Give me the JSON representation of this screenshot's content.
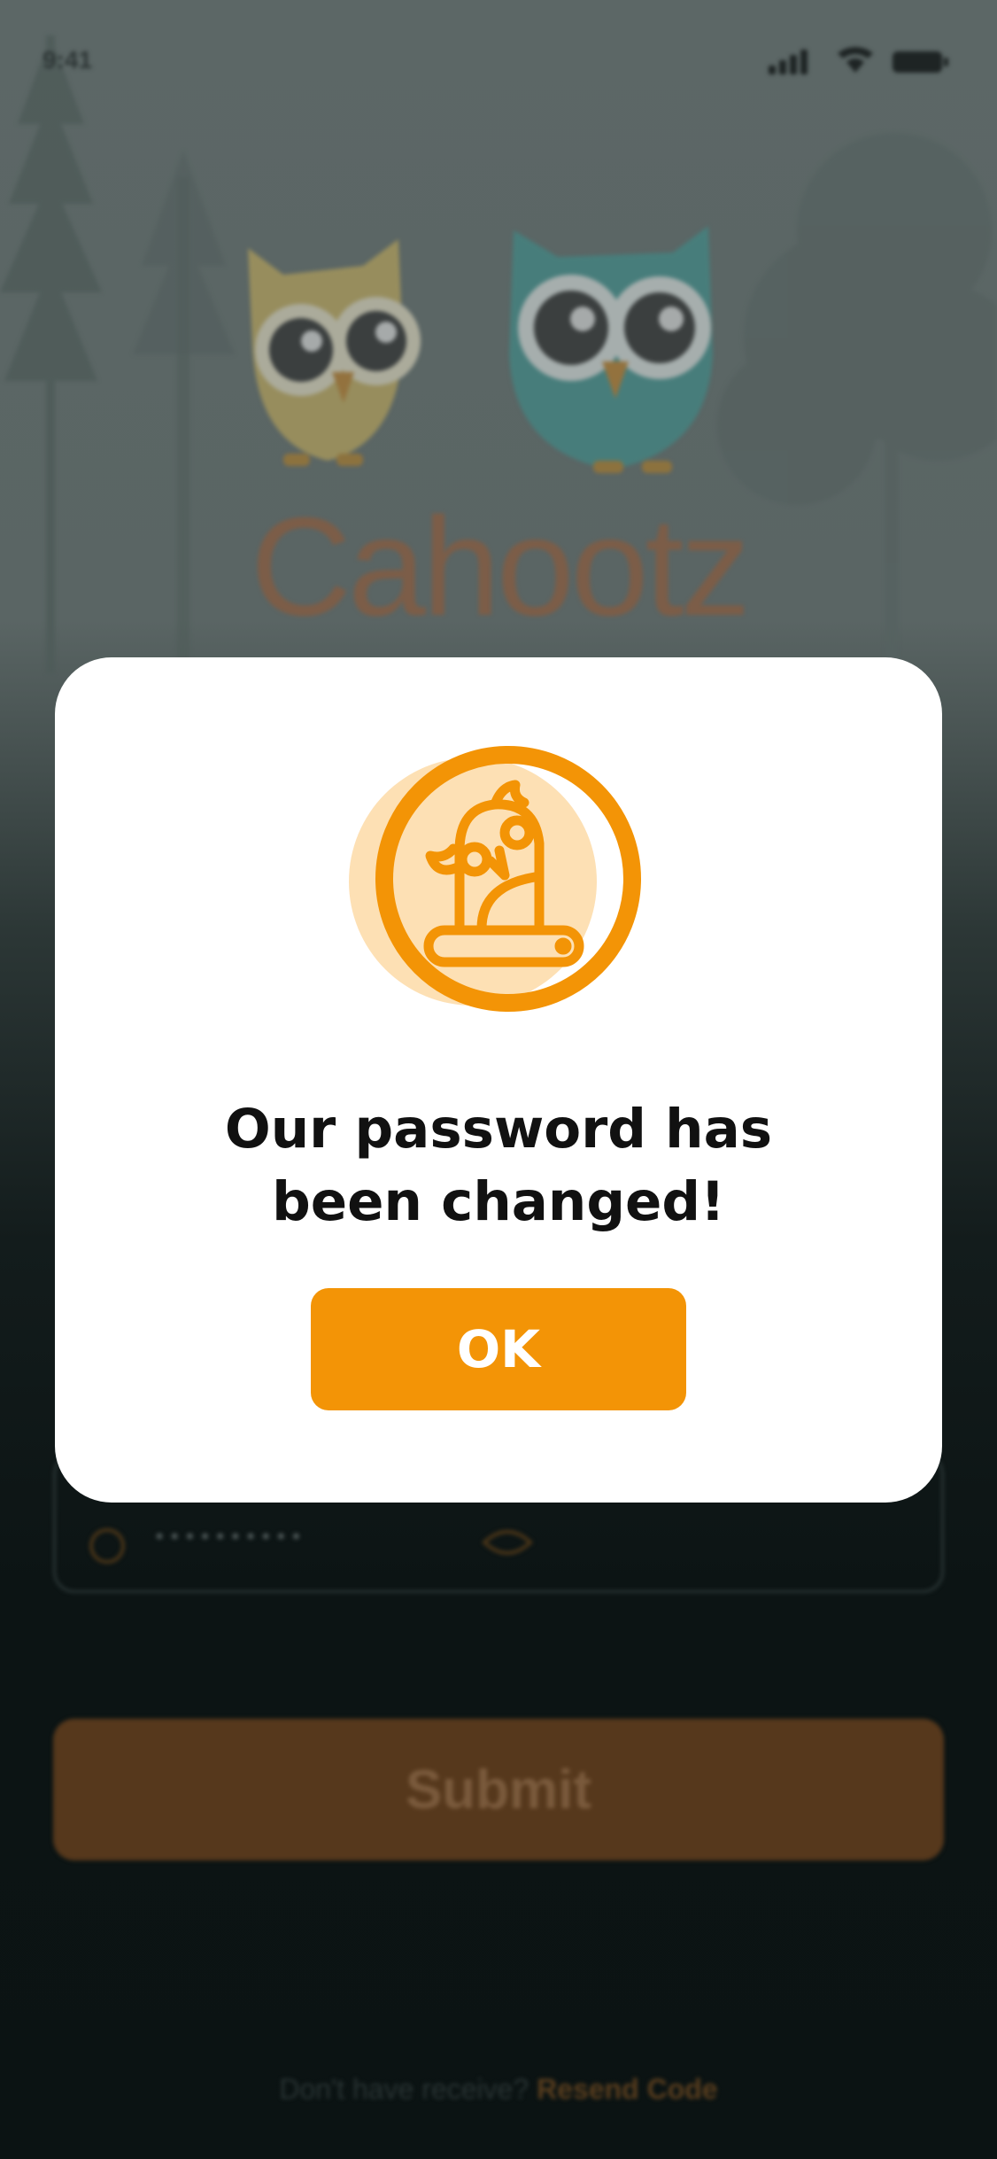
{
  "status_bar": {
    "time": "9:41",
    "signal_icon": "cellular-signal-icon",
    "wifi_icon": "wifi-icon",
    "battery_icon": "battery-icon"
  },
  "background": {
    "app_name": "Cahootz",
    "password_placeholder": "••••••••••",
    "submit_label": "Submit",
    "resend_prompt": "Don't have receive? ",
    "resend_link": "Resend Code"
  },
  "modal": {
    "icon": "owl-on-branch-icon",
    "title": "Our password has\nbeen changed!",
    "ok_label": "OK"
  },
  "colors": {
    "accent": "#f39406",
    "accent_light": "#fde0b4",
    "overlay_dark": "#0e1616"
  }
}
